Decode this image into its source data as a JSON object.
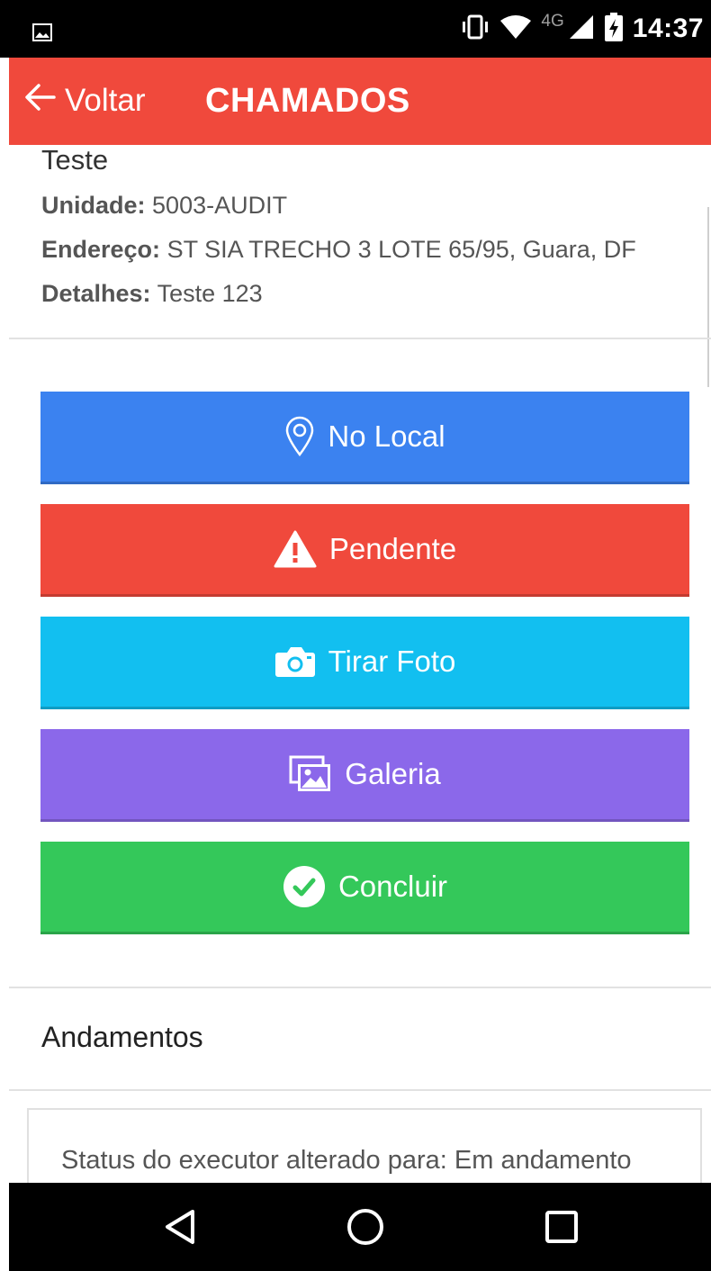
{
  "status_bar": {
    "network": "4G",
    "time": "14:37"
  },
  "app_bar": {
    "back_label": "Voltar",
    "title": "CHAMADOS"
  },
  "ticket": {
    "name": "Teste",
    "unidade_label": "Unidade:",
    "unidade_value": "5003-AUDIT",
    "endereco_label": "Endereço:",
    "endereco_value": "ST SIA TRECHO 3 LOTE 65/95, Guara, DF",
    "detalhes_label": "Detalhes:",
    "detalhes_value": "Teste 123"
  },
  "actions": [
    {
      "label": "No Local",
      "icon": "map-pin-icon",
      "color": "#3b82f0"
    },
    {
      "label": "Pendente",
      "icon": "warning-icon",
      "color": "#f0493c"
    },
    {
      "label": "Tirar Foto",
      "icon": "camera-icon",
      "color": "#12bff0"
    },
    {
      "label": "Galeria",
      "icon": "gallery-icon",
      "color": "#8b68ea"
    },
    {
      "label": "Concluir",
      "icon": "check-circle-icon",
      "color": "#34c85a"
    }
  ],
  "andamentos": {
    "title": "Andamentos",
    "items": [
      {
        "text": "Status do executor alterado para: Em andamento"
      }
    ]
  },
  "nav_bar": {
    "icons": [
      "back-triangle-icon",
      "home-circle-icon",
      "recents-square-icon"
    ]
  }
}
